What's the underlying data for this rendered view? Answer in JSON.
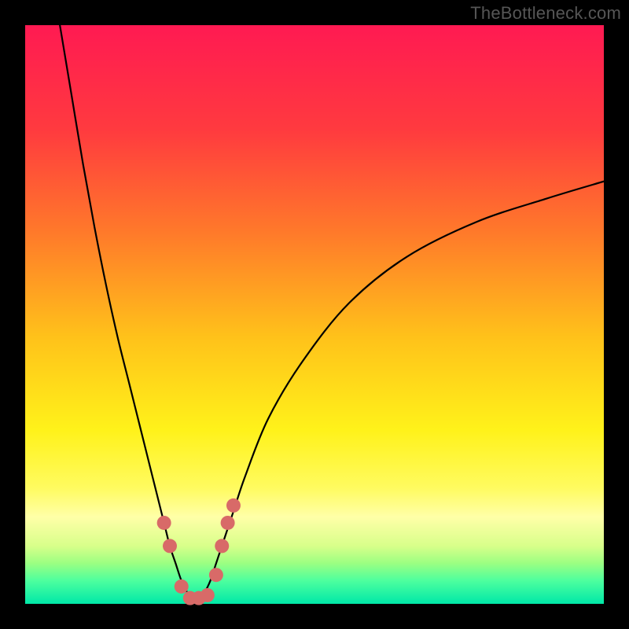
{
  "watermark": {
    "text": "TheBottleneck.com"
  },
  "gradient": {
    "stops": [
      {
        "offset": 0.0,
        "color": "#ff1a52"
      },
      {
        "offset": 0.18,
        "color": "#ff3a3f"
      },
      {
        "offset": 0.36,
        "color": "#ff7a2a"
      },
      {
        "offset": 0.54,
        "color": "#ffc21a"
      },
      {
        "offset": 0.7,
        "color": "#fff21a"
      },
      {
        "offset": 0.8,
        "color": "#fffb60"
      },
      {
        "offset": 0.85,
        "color": "#ffffa8"
      },
      {
        "offset": 0.9,
        "color": "#d8ff8a"
      },
      {
        "offset": 0.93,
        "color": "#9bff82"
      },
      {
        "offset": 0.96,
        "color": "#4dff9e"
      },
      {
        "offset": 1.0,
        "color": "#00e8a8"
      }
    ]
  },
  "chart_data": {
    "type": "line",
    "title": "",
    "xlabel": "",
    "ylabel": "",
    "xlim": [
      0,
      100
    ],
    "ylim": [
      0,
      100
    ],
    "series": [
      {
        "name": "bottleneck-curve",
        "x": [
          6,
          8,
          10,
          12,
          14,
          16,
          18,
          20,
          22,
          24,
          25,
          26,
          27,
          28,
          29,
          30,
          31,
          32,
          33,
          34,
          36,
          38,
          42,
          48,
          56,
          66,
          78,
          90,
          100
        ],
        "y": [
          100,
          88,
          76,
          65,
          55,
          46,
          38,
          30,
          22,
          14,
          10,
          7,
          4,
          2,
          1,
          1,
          2,
          4,
          7,
          10,
          16,
          22,
          32,
          42,
          52,
          60,
          66,
          70,
          73
        ]
      }
    ],
    "markers": {
      "name": "highlight-points",
      "color": "#d86a68",
      "radius": 9,
      "points": [
        {
          "x": 24.0,
          "y": 14.0
        },
        {
          "x": 25.0,
          "y": 10.0
        },
        {
          "x": 27.0,
          "y": 3.0
        },
        {
          "x": 28.5,
          "y": 1.0
        },
        {
          "x": 30.0,
          "y": 1.0
        },
        {
          "x": 31.5,
          "y": 1.5
        },
        {
          "x": 33.0,
          "y": 5.0
        },
        {
          "x": 34.0,
          "y": 10.0
        },
        {
          "x": 35.0,
          "y": 14.0
        },
        {
          "x": 36.0,
          "y": 17.0
        }
      ]
    }
  }
}
